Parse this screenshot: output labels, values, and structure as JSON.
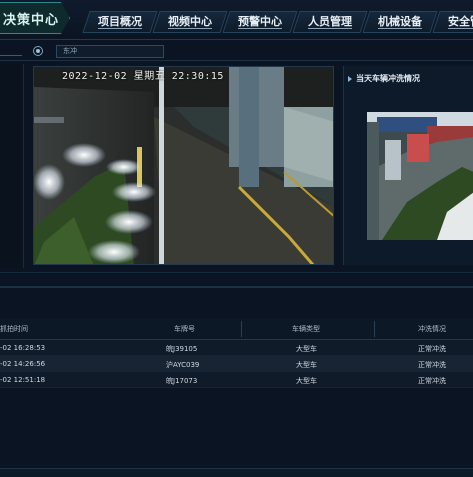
{
  "brand": {
    "title": "决策中心"
  },
  "nav": {
    "tabs": [
      {
        "label": "项目概况"
      },
      {
        "label": "视频中心"
      },
      {
        "label": "预警中心"
      },
      {
        "label": "人员管理"
      },
      {
        "label": "机械设备"
      },
      {
        "label": "安全管理"
      }
    ]
  },
  "toolbar": {
    "select_value": "东冲"
  },
  "camera": {
    "overlay": "2022-12-02  星期五  22:30:15"
  },
  "right_panel": {
    "title": "当天车辆冲洗情况"
  },
  "table": {
    "columns": [
      "抓拍时间",
      "车牌号",
      "车辆类型",
      "冲洗情况"
    ],
    "rows": [
      {
        "time": "-02 16:28:53",
        "plate": "皖J39105",
        "type": "大型车",
        "status": "正常冲洗"
      },
      {
        "time": "-02 14:26:56",
        "plate": "沪AYC039",
        "type": "大型车",
        "status": "正常冲洗"
      },
      {
        "time": "-02 12:51:18",
        "plate": "皖J17073",
        "type": "大型车",
        "status": "正常冲洗"
      }
    ]
  },
  "colors": {
    "accent": "#2b8a8f",
    "background": "#0b1422"
  }
}
